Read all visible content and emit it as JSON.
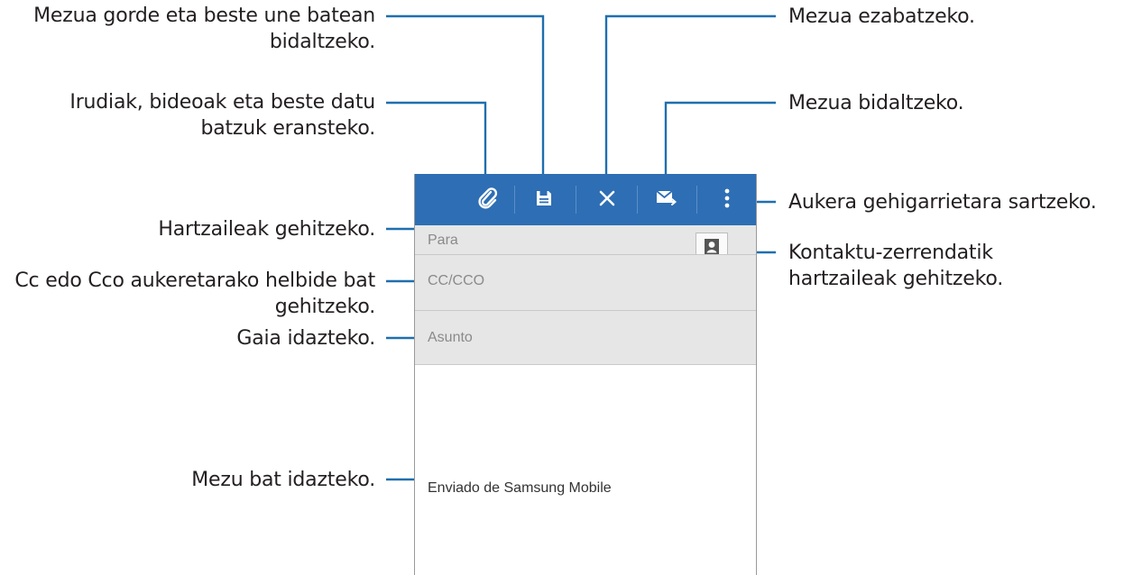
{
  "callouts": {
    "save": "Mezua gorde eta beste une batean bidaltzeko.",
    "attach": "Irudiak, bideoak eta beste datu batzuk eransteko.",
    "recipients": "Hartzaileak gehitzeko.",
    "cc": "Cc edo Cco aukeretarako helbide bat gehitzeko.",
    "subject": "Gaia idazteko.",
    "message": "Mezu bat idazteko.",
    "delete": "Mezua ezabatzeko.",
    "send": "Mezua bidaltzeko.",
    "more": "Aukera gehigarrietara sartzeko.",
    "contacts": "Kontaktu-zerrendatik hartzaileak gehitzeko."
  },
  "screen": {
    "to_label": "Para",
    "cc_label": "CC/CCO",
    "subject_label": "Asunto",
    "signature": "Enviado de Samsung Mobile"
  },
  "icons": {
    "attach": "paperclip-icon",
    "save": "floppy-disk-icon",
    "delete": "close-icon",
    "send": "send-mail-icon",
    "more": "more-vertical-icon",
    "contacts": "contact-card-icon"
  },
  "colors": {
    "toolbar": "#2e6eb4",
    "leader_lines": "#1f6fae",
    "field_background": "#e6e6e6"
  }
}
